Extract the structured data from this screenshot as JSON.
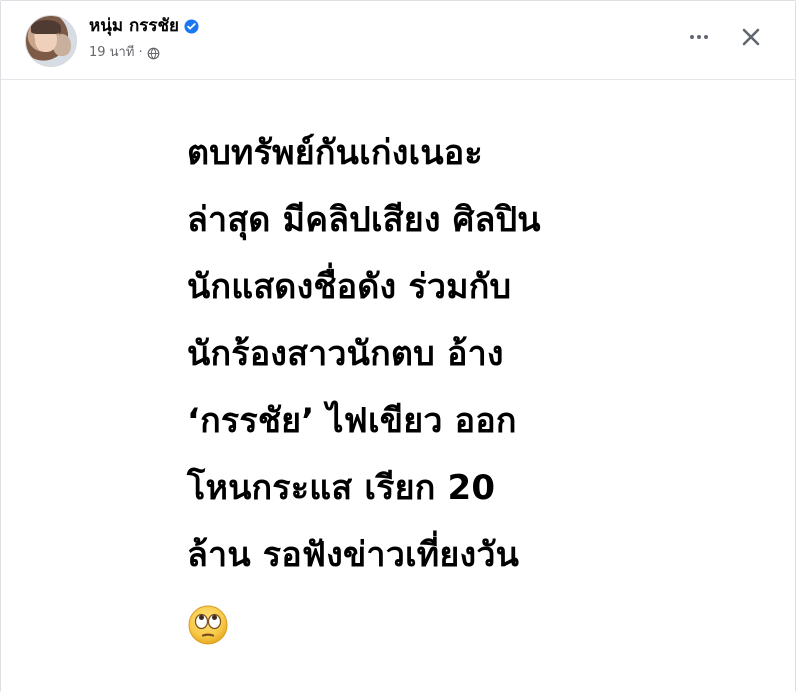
{
  "post": {
    "author_name": "หนุ่ม กรรชัย",
    "verified_icon": "verified-badge-icon",
    "time_text": "19 นาที",
    "separator": "·",
    "privacy_icon": "globe-icon",
    "more_icon": "more-options-icon",
    "close_icon": "close-icon",
    "text_lines": [
      "ตบทรัพย์กันเก่งเนอะ",
      "ล่าสุด มีคลิปเสียง ศิลปิน",
      "นักแสดงชื่อดัง ร่วมกับ",
      "นักร้องสาวนักตบ อ้าง",
      "‘กรรชัย’ ไฟเขียว ออก",
      "โหนกระแส เรียก 20",
      "ล้าน รอฟังข่าวเที่ยงวัน"
    ],
    "emoji_icon": "face-with-rolling-eyes-icon"
  },
  "colors": {
    "verified_blue": "#1877f2",
    "meta_gray": "#65676b",
    "text_black": "#000000",
    "emoji_yellow": "#f7c948"
  }
}
